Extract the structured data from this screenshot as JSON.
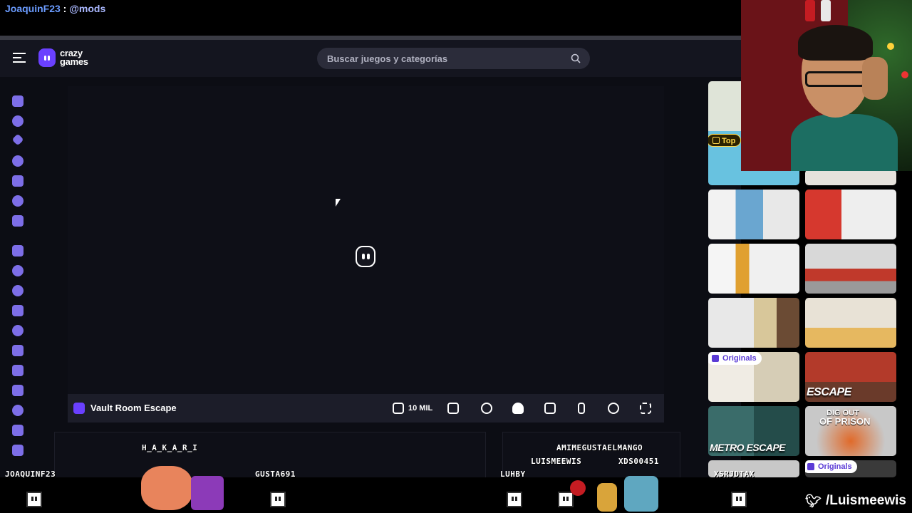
{
  "stream_chat": {
    "user": "JoaquinF23",
    "separator": " : ",
    "mention": "@mods"
  },
  "header": {
    "logo_text_line1": "crazy",
    "logo_text_line2": "games",
    "search_placeholder": "Buscar juegos y categorías"
  },
  "sidebar": {
    "icons": [
      "home-icon",
      "clock-icon",
      "sparkle-icon",
      "flame-icon",
      "refresh-icon",
      "crown-icon",
      "users-icon",
      "bolt-icon",
      "compass-icon",
      "ball-icon",
      "key-icon",
      "controller-icon",
      "pawn-icon",
      "plane-icon",
      "car-icon",
      "steering-icon",
      "gamepad-icon",
      "puzzle-icon"
    ]
  },
  "game": {
    "title": "Vault Room Escape",
    "like_count": "10 MIL"
  },
  "thumbnails": {
    "badge_top": "Top",
    "badge_originals": "Originals",
    "label_escape": "ESCAPE",
    "label_metro": "METRO ESCAPE",
    "label_dig1": "DIG OUT",
    "label_dig2": "OF PRISON"
  },
  "overlay": {
    "names": [
      "H_A_K_A_R_I",
      "JOAQUINF23",
      "GUSTA691",
      "AMIMEGUSTAELMANGO",
      "LUISMEEWIS",
      "XDS00451",
      "LUHBY",
      "XSRJDTAX"
    ],
    "twitter_handle": "/Luismeewis"
  }
}
